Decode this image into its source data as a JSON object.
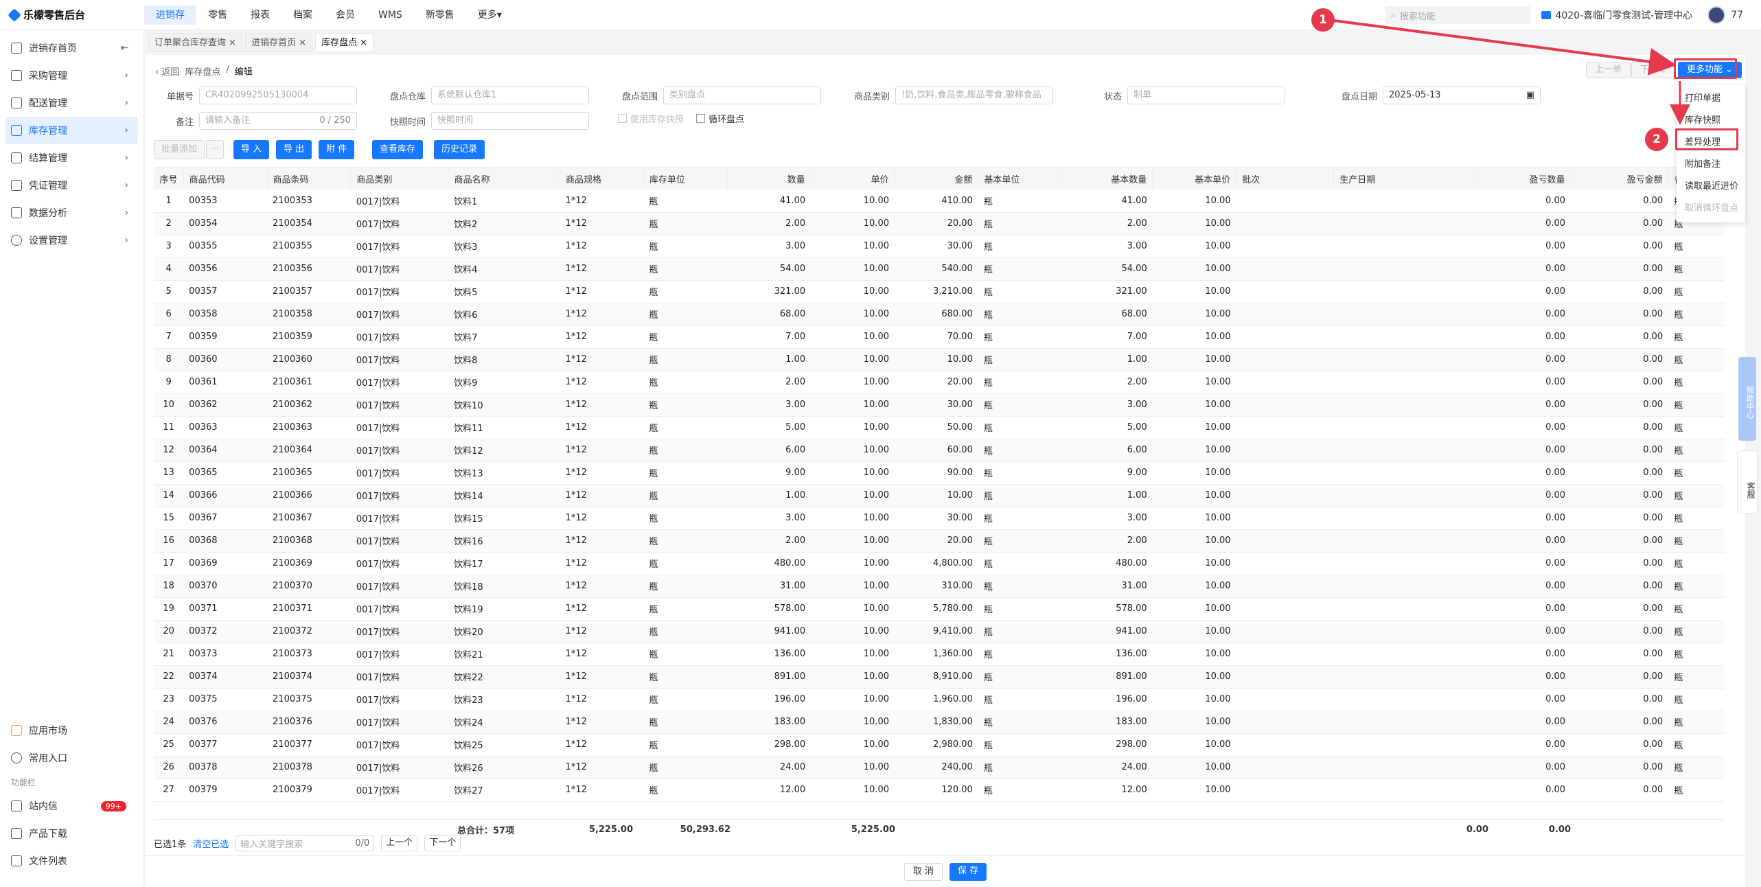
{
  "app": {
    "title": "乐檬零售后台"
  },
  "topnav": [
    "进销存",
    "零售",
    "报表",
    "档案",
    "会员",
    "WMS",
    "新零售",
    "更多"
  ],
  "search": {
    "placeholder": "搜索功能"
  },
  "store": "4020-喜临门零食测试-管理中心",
  "user": "77",
  "sidebar": {
    "items": [
      "进销存首页",
      "采购管理",
      "配送管理",
      "库存管理",
      "结算管理",
      "凭证管理",
      "数据分析",
      "设置管理"
    ],
    "bottom": {
      "app_market": "应用市场",
      "common_entry": "常用入口",
      "func_bar": "功能栏",
      "inbox": "站内信",
      "inbox_badge": "99+",
      "download": "产品下载",
      "files": "文件列表"
    }
  },
  "tabs": [
    "订单聚合库存查询",
    "进销存首页",
    "库存盘点"
  ],
  "breadcrumb": {
    "back": "返回",
    "parent": "库存盘点",
    "current": "编辑"
  },
  "form": {
    "doc_no_label": "单据号",
    "doc_no": "CR4020992505130004",
    "warehouse_label": "盘点仓库",
    "warehouse": "系统默认仓库1",
    "range_label": "盘点范围",
    "range": "类别盘点",
    "category_label": "商品类别",
    "category": "!奶,饮料,食品类,膨品零食,歌称食品",
    "status_label": "状态",
    "status": "制单",
    "date_label": "盘点日期",
    "date": "2025-05-13",
    "remark_label": "备注",
    "remark_ph": "请输入备注",
    "remark_count": "0 / 250",
    "snap_label": "快照时间",
    "snap_ph": "快照时间",
    "use_snap": "使用库存快照",
    "cycle": "循环盘点"
  },
  "toolbar": {
    "batch_add": "批量添加",
    "more": "···",
    "import": "导 入",
    "export": "导 出",
    "attach": "附 件",
    "view_stock": "查看库存",
    "history": "历史记录",
    "prev": "上一单",
    "next": "下一单",
    "more_func": "更多功能"
  },
  "dropdown": [
    "打印单据",
    "库存快照",
    "差异处理",
    "附加备注",
    "读取最近进价",
    "取消循环盘点"
  ],
  "markers": [
    "1",
    "2"
  ],
  "table": {
    "headers": [
      "序号",
      "商品代码",
      "商品条码",
      "商品类别",
      "商品名称",
      "商品规格",
      "库存单位",
      "数量",
      "单价",
      "金额",
      "基本单位",
      "基本数量",
      "基本单价",
      "批次",
      "生产日期",
      "盈亏数量",
      "盈亏金额",
      "备注"
    ],
    "rows": [
      [
        "1",
        "00353",
        "2100353",
        "0017|饮料",
        "饮料1",
        "1*12",
        "瓶",
        "41.00",
        "10.00",
        "410.00",
        "瓶",
        "41.00",
        "10.00",
        "",
        "",
        "0.00",
        "0.00",
        "瓶"
      ],
      [
        "2",
        "00354",
        "2100354",
        "0017|饮料",
        "饮料2",
        "1*12",
        "瓶",
        "2.00",
        "10.00",
        "20.00",
        "瓶",
        "2.00",
        "10.00",
        "",
        "",
        "0.00",
        "0.00",
        "瓶"
      ],
      [
        "3",
        "00355",
        "2100355",
        "0017|饮料",
        "饮料3",
        "1*12",
        "瓶",
        "3.00",
        "10.00",
        "30.00",
        "瓶",
        "3.00",
        "10.00",
        "",
        "",
        "0.00",
        "0.00",
        "瓶"
      ],
      [
        "4",
        "00356",
        "2100356",
        "0017|饮料",
        "饮料4",
        "1*12",
        "瓶",
        "54.00",
        "10.00",
        "540.00",
        "瓶",
        "54.00",
        "10.00",
        "",
        "",
        "0.00",
        "0.00",
        "瓶"
      ],
      [
        "5",
        "00357",
        "2100357",
        "0017|饮料",
        "饮料5",
        "1*12",
        "瓶",
        "321.00",
        "10.00",
        "3,210.00",
        "瓶",
        "321.00",
        "10.00",
        "",
        "",
        "0.00",
        "0.00",
        "瓶"
      ],
      [
        "6",
        "00358",
        "2100358",
        "0017|饮料",
        "饮料6",
        "1*12",
        "瓶",
        "68.00",
        "10.00",
        "680.00",
        "瓶",
        "68.00",
        "10.00",
        "",
        "",
        "0.00",
        "0.00",
        "瓶"
      ],
      [
        "7",
        "00359",
        "2100359",
        "0017|饮料",
        "饮料7",
        "1*12",
        "瓶",
        "7.00",
        "10.00",
        "70.00",
        "瓶",
        "7.00",
        "10.00",
        "",
        "",
        "0.00",
        "0.00",
        "瓶"
      ],
      [
        "8",
        "00360",
        "2100360",
        "0017|饮料",
        "饮料8",
        "1*12",
        "瓶",
        "1.00",
        "10.00",
        "10.00",
        "瓶",
        "1.00",
        "10.00",
        "",
        "",
        "0.00",
        "0.00",
        "瓶"
      ],
      [
        "9",
        "00361",
        "2100361",
        "0017|饮料",
        "饮料9",
        "1*12",
        "瓶",
        "2.00",
        "10.00",
        "20.00",
        "瓶",
        "2.00",
        "10.00",
        "",
        "",
        "0.00",
        "0.00",
        "瓶"
      ],
      [
        "10",
        "00362",
        "2100362",
        "0017|饮料",
        "饮料10",
        "1*12",
        "瓶",
        "3.00",
        "10.00",
        "30.00",
        "瓶",
        "3.00",
        "10.00",
        "",
        "",
        "0.00",
        "0.00",
        "瓶"
      ],
      [
        "11",
        "00363",
        "2100363",
        "0017|饮料",
        "饮料11",
        "1*12",
        "瓶",
        "5.00",
        "10.00",
        "50.00",
        "瓶",
        "5.00",
        "10.00",
        "",
        "",
        "0.00",
        "0.00",
        "瓶"
      ],
      [
        "12",
        "00364",
        "2100364",
        "0017|饮料",
        "饮料12",
        "1*12",
        "瓶",
        "6.00",
        "10.00",
        "60.00",
        "瓶",
        "6.00",
        "10.00",
        "",
        "",
        "0.00",
        "0.00",
        "瓶"
      ],
      [
        "13",
        "00365",
        "2100365",
        "0017|饮料",
        "饮料13",
        "1*12",
        "瓶",
        "9.00",
        "10.00",
        "90.00",
        "瓶",
        "9.00",
        "10.00",
        "",
        "",
        "0.00",
        "0.00",
        "瓶"
      ],
      [
        "14",
        "00366",
        "2100366",
        "0017|饮料",
        "饮料14",
        "1*12",
        "瓶",
        "1.00",
        "10.00",
        "10.00",
        "瓶",
        "1.00",
        "10.00",
        "",
        "",
        "0.00",
        "0.00",
        "瓶"
      ],
      [
        "15",
        "00367",
        "2100367",
        "0017|饮料",
        "饮料15",
        "1*12",
        "瓶",
        "3.00",
        "10.00",
        "30.00",
        "瓶",
        "3.00",
        "10.00",
        "",
        "",
        "0.00",
        "0.00",
        "瓶"
      ],
      [
        "16",
        "00368",
        "2100368",
        "0017|饮料",
        "饮料16",
        "1*12",
        "瓶",
        "2.00",
        "10.00",
        "20.00",
        "瓶",
        "2.00",
        "10.00",
        "",
        "",
        "0.00",
        "0.00",
        "瓶"
      ],
      [
        "17",
        "00369",
        "2100369",
        "0017|饮料",
        "饮料17",
        "1*12",
        "瓶",
        "480.00",
        "10.00",
        "4,800.00",
        "瓶",
        "480.00",
        "10.00",
        "",
        "",
        "0.00",
        "0.00",
        "瓶"
      ],
      [
        "18",
        "00370",
        "2100370",
        "0017|饮料",
        "饮料18",
        "1*12",
        "瓶",
        "31.00",
        "10.00",
        "310.00",
        "瓶",
        "31.00",
        "10.00",
        "",
        "",
        "0.00",
        "0.00",
        "瓶"
      ],
      [
        "19",
        "00371",
        "2100371",
        "0017|饮料",
        "饮料19",
        "1*12",
        "瓶",
        "578.00",
        "10.00",
        "5,780.00",
        "瓶",
        "578.00",
        "10.00",
        "",
        "",
        "0.00",
        "0.00",
        "瓶"
      ],
      [
        "20",
        "00372",
        "2100372",
        "0017|饮料",
        "饮料20",
        "1*12",
        "瓶",
        "941.00",
        "10.00",
        "9,410.00",
        "瓶",
        "941.00",
        "10.00",
        "",
        "",
        "0.00",
        "0.00",
        "瓶"
      ],
      [
        "21",
        "00373",
        "2100373",
        "0017|饮料",
        "饮料21",
        "1*12",
        "瓶",
        "136.00",
        "10.00",
        "1,360.00",
        "瓶",
        "136.00",
        "10.00",
        "",
        "",
        "0.00",
        "0.00",
        "瓶"
      ],
      [
        "22",
        "00374",
        "2100374",
        "0017|饮料",
        "饮料22",
        "1*12",
        "瓶",
        "891.00",
        "10.00",
        "8,910.00",
        "瓶",
        "891.00",
        "10.00",
        "",
        "",
        "0.00",
        "0.00",
        "瓶"
      ],
      [
        "23",
        "00375",
        "2100375",
        "0017|饮料",
        "饮料23",
        "1*12",
        "瓶",
        "196.00",
        "10.00",
        "1,960.00",
        "瓶",
        "196.00",
        "10.00",
        "",
        "",
        "0.00",
        "0.00",
        "瓶"
      ],
      [
        "24",
        "00376",
        "2100376",
        "0017|饮料",
        "饮料24",
        "1*12",
        "瓶",
        "183.00",
        "10.00",
        "1,830.00",
        "瓶",
        "183.00",
        "10.00",
        "",
        "",
        "0.00",
        "0.00",
        "瓶"
      ],
      [
        "25",
        "00377",
        "2100377",
        "0017|饮料",
        "饮料25",
        "1*12",
        "瓶",
        "298.00",
        "10.00",
        "2,980.00",
        "瓶",
        "298.00",
        "10.00",
        "",
        "",
        "0.00",
        "0.00",
        "瓶"
      ],
      [
        "26",
        "00378",
        "2100378",
        "0017|饮料",
        "饮料26",
        "1*12",
        "瓶",
        "24.00",
        "10.00",
        "240.00",
        "瓶",
        "24.00",
        "10.00",
        "",
        "",
        "0.00",
        "0.00",
        "瓶"
      ],
      [
        "27",
        "00379",
        "2100379",
        "0017|饮料",
        "饮料27",
        "1*12",
        "瓶",
        "12.00",
        "10.00",
        "120.00",
        "瓶",
        "12.00",
        "10.00",
        "",
        "",
        "0.00",
        "0.00",
        "瓶"
      ]
    ],
    "total": {
      "label": "总合计：57项",
      "qty": "5,225.00",
      "amount": "50,293.62",
      "base_qty": "5,225.00",
      "diff_qty": "0.00",
      "diff_amount": "0.00"
    }
  },
  "footer": {
    "selected": "已选1条",
    "clear": "清空已选",
    "kw_ph": "输入关键字搜索",
    "kw_count": "0/0",
    "prev": "上一个",
    "next": "下一个"
  },
  "actions": {
    "cancel": "取 消",
    "save": "保 存"
  },
  "side_float": {
    "help": "帮助中心",
    "kefu": "客服"
  }
}
